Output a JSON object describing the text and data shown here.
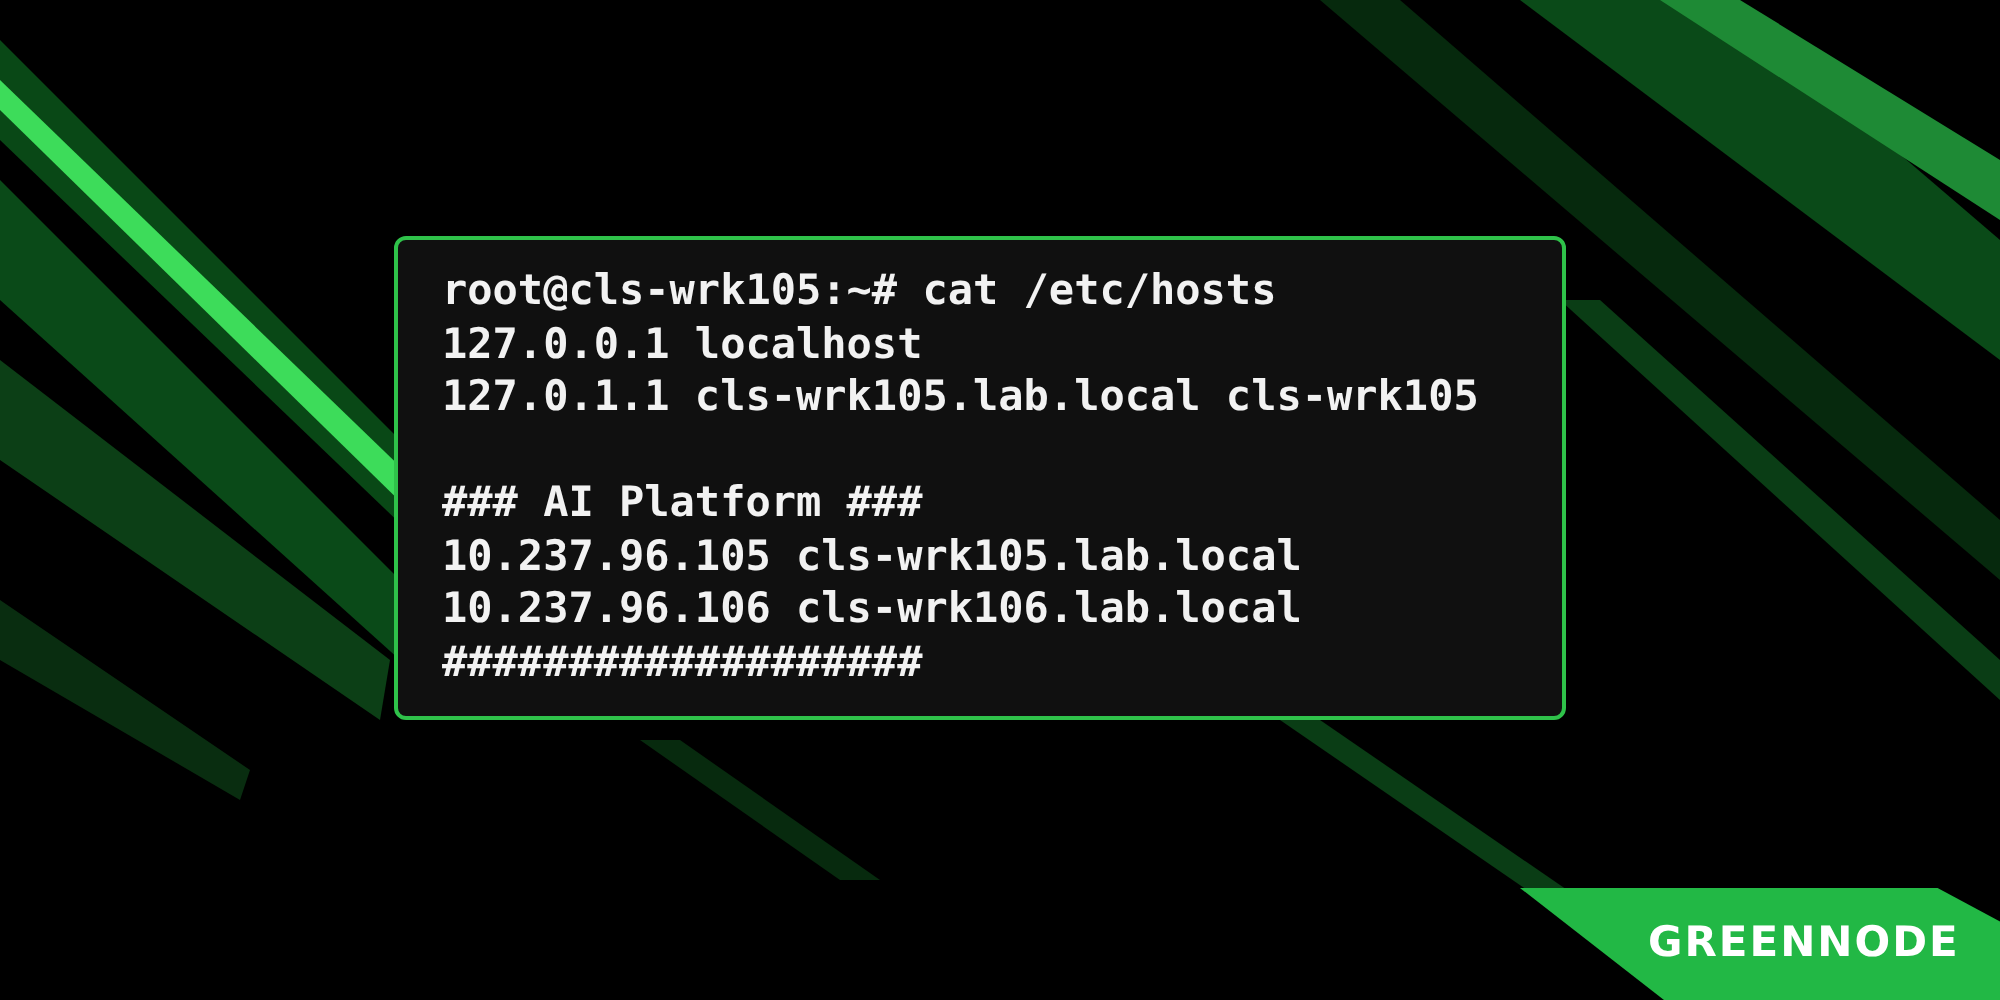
{
  "terminal": {
    "lines": [
      {
        "kind": "command",
        "text": "root@cls-wrk105:~# cat /etc/hosts"
      },
      {
        "kind": "output",
        "text": "127.0.0.1 localhost"
      },
      {
        "kind": "output",
        "text": "127.0.1.1 cls-wrk105.lab.local cls-wrk105"
      },
      {
        "kind": "blank"
      },
      {
        "kind": "output",
        "text": "### AI Platform ###"
      },
      {
        "kind": "output",
        "text": "10.237.96.105 cls-wrk105.lab.local"
      },
      {
        "kind": "output",
        "text": "10.237.96.106 cls-wrk106.lab.local"
      },
      {
        "kind": "output",
        "text": "###################"
      }
    ]
  },
  "logo": {
    "text": "GREENNODE"
  }
}
